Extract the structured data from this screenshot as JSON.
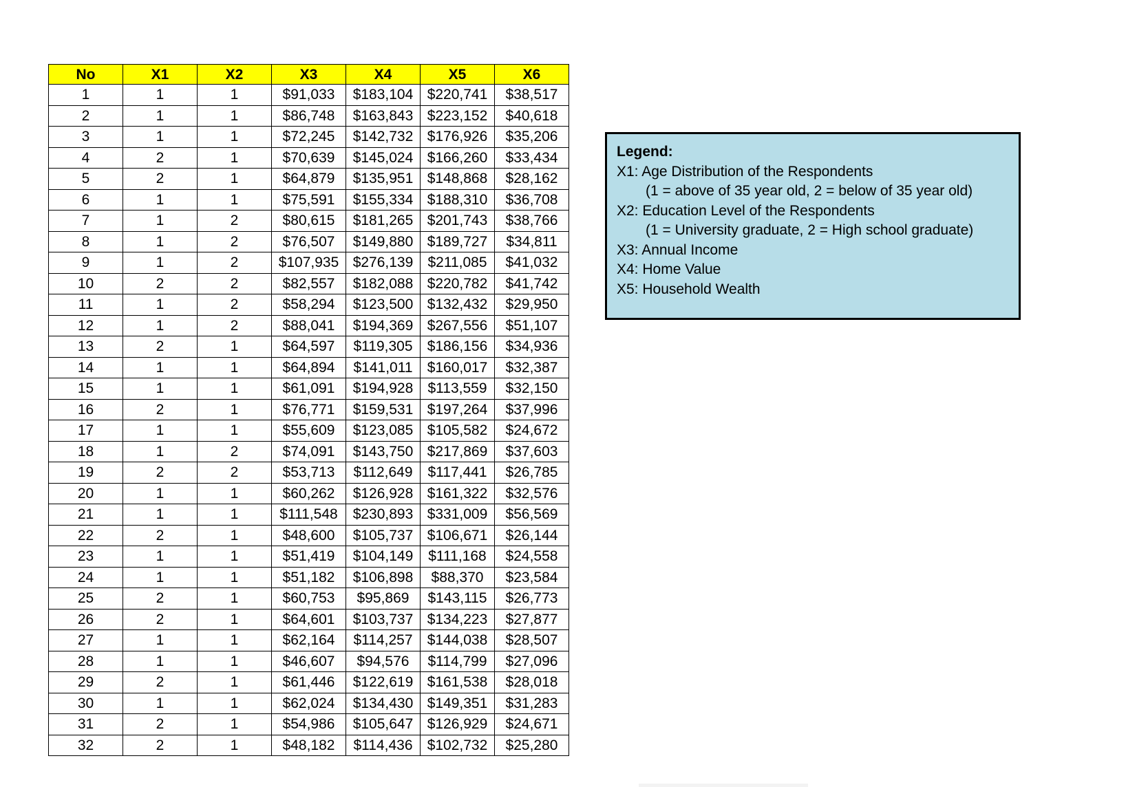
{
  "table": {
    "headers": [
      "No",
      "X1",
      "X2",
      "X3",
      "X4",
      "X5",
      "X6"
    ],
    "header_color": "#ffff00",
    "rows": [
      [
        "1",
        "1",
        "1",
        "$91,033",
        "$183,104",
        "$220,741",
        "$38,517"
      ],
      [
        "2",
        "1",
        "1",
        "$86,748",
        "$163,843",
        "$223,152",
        "$40,618"
      ],
      [
        "3",
        "1",
        "1",
        "$72,245",
        "$142,732",
        "$176,926",
        "$35,206"
      ],
      [
        "4",
        "2",
        "1",
        "$70,639",
        "$145,024",
        "$166,260",
        "$33,434"
      ],
      [
        "5",
        "2",
        "1",
        "$64,879",
        "$135,951",
        "$148,868",
        "$28,162"
      ],
      [
        "6",
        "1",
        "1",
        "$75,591",
        "$155,334",
        "$188,310",
        "$36,708"
      ],
      [
        "7",
        "1",
        "2",
        "$80,615",
        "$181,265",
        "$201,743",
        "$38,766"
      ],
      [
        "8",
        "1",
        "2",
        "$76,507",
        "$149,880",
        "$189,727",
        "$34,811"
      ],
      [
        "9",
        "1",
        "2",
        "$107,935",
        "$276,139",
        "$211,085",
        "$41,032"
      ],
      [
        "10",
        "2",
        "2",
        "$82,557",
        "$182,088",
        "$220,782",
        "$41,742"
      ],
      [
        "11",
        "1",
        "2",
        "$58,294",
        "$123,500",
        "$132,432",
        "$29,950"
      ],
      [
        "12",
        "1",
        "2",
        "$88,041",
        "$194,369",
        "$267,556",
        "$51,107"
      ],
      [
        "13",
        "2",
        "1",
        "$64,597",
        "$119,305",
        "$186,156",
        "$34,936"
      ],
      [
        "14",
        "1",
        "1",
        "$64,894",
        "$141,011",
        "$160,017",
        "$32,387"
      ],
      [
        "15",
        "1",
        "1",
        "$61,091",
        "$194,928",
        "$113,559",
        "$32,150"
      ],
      [
        "16",
        "2",
        "1",
        "$76,771",
        "$159,531",
        "$197,264",
        "$37,996"
      ],
      [
        "17",
        "1",
        "1",
        "$55,609",
        "$123,085",
        "$105,582",
        "$24,672"
      ],
      [
        "18",
        "1",
        "2",
        "$74,091",
        "$143,750",
        "$217,869",
        "$37,603"
      ],
      [
        "19",
        "2",
        "2",
        "$53,713",
        "$112,649",
        "$117,441",
        "$26,785"
      ],
      [
        "20",
        "1",
        "1",
        "$60,262",
        "$126,928",
        "$161,322",
        "$32,576"
      ],
      [
        "21",
        "1",
        "1",
        "$111,548",
        "$230,893",
        "$331,009",
        "$56,569"
      ],
      [
        "22",
        "2",
        "1",
        "$48,600",
        "$105,737",
        "$106,671",
        "$26,144"
      ],
      [
        "23",
        "1",
        "1",
        "$51,419",
        "$104,149",
        "$111,168",
        "$24,558"
      ],
      [
        "24",
        "1",
        "1",
        "$51,182",
        "$106,898",
        "$88,370",
        "$23,584"
      ],
      [
        "25",
        "2",
        "1",
        "$60,753",
        "$95,869",
        "$143,115",
        "$26,773"
      ],
      [
        "26",
        "2",
        "1",
        "$64,601",
        "$103,737",
        "$134,223",
        "$27,877"
      ],
      [
        "27",
        "1",
        "1",
        "$62,164",
        "$114,257",
        "$144,038",
        "$28,507"
      ],
      [
        "28",
        "1",
        "1",
        "$46,607",
        "$94,576",
        "$114,799",
        "$27,096"
      ],
      [
        "29",
        "2",
        "1",
        "$61,446",
        "$122,619",
        "$161,538",
        "$28,018"
      ],
      [
        "30",
        "1",
        "1",
        "$62,024",
        "$134,430",
        "$149,351",
        "$31,283"
      ],
      [
        "31",
        "2",
        "1",
        "$54,986",
        "$105,647",
        "$126,929",
        "$24,671"
      ],
      [
        "32",
        "2",
        "1",
        "$48,182",
        "$114,436",
        "$102,732",
        "$25,280"
      ]
    ]
  },
  "legend": {
    "background_color": "#b7dde8",
    "title": "Legend:",
    "lines": [
      {
        "text": "X1: Age Distribution of the Respondents",
        "indent": false
      },
      {
        "text": "(1 = above of 35 year old, 2 = below of 35 year old)",
        "indent": true
      },
      {
        "text": "X2: Education Level of the Respondents",
        "indent": false
      },
      {
        "text": "(1 = University graduate, 2 = High school graduate)",
        "indent": true
      },
      {
        "text": "X3: Annual Income",
        "indent": false
      },
      {
        "text": "X4: Home Value",
        "indent": false
      },
      {
        "text": "X5: Household Wealth",
        "indent": false
      }
    ]
  }
}
